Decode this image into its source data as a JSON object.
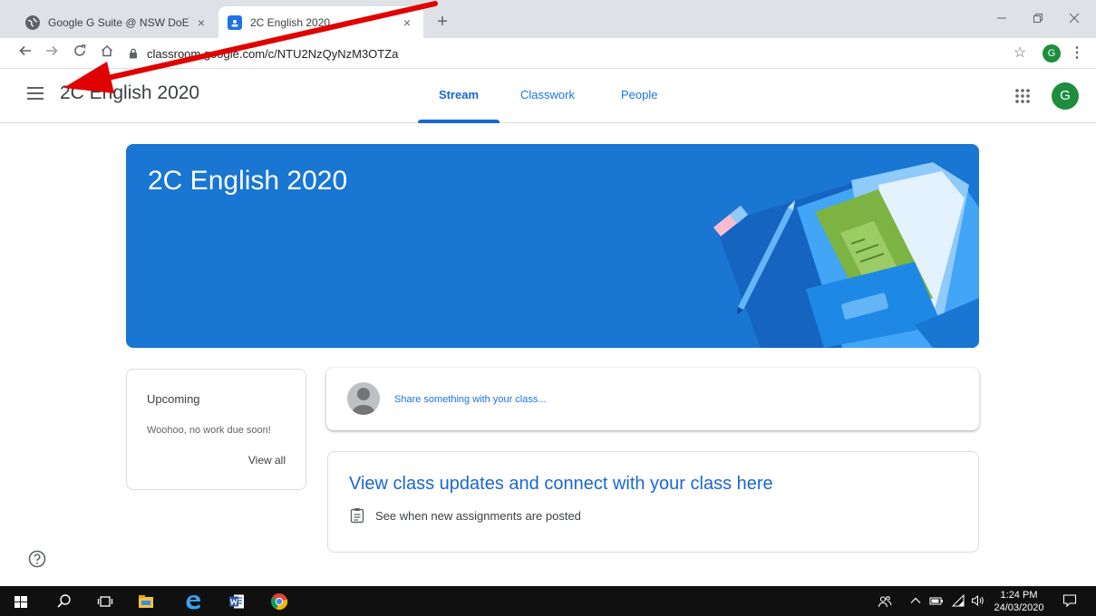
{
  "browser": {
    "tabs": [
      {
        "title": "Google G Suite @ NSW DoE",
        "active": false
      },
      {
        "title": "2C English 2020",
        "active": true
      }
    ],
    "new_tab": "+",
    "close": "×",
    "url": "classroom.google.com/c/NTU2NzQyNzM3OTZa",
    "profile_initial": "G"
  },
  "appbar": {
    "class_name": "2C English 2020",
    "tabs": [
      {
        "label": "Stream",
        "selected": true
      },
      {
        "label": "Classwork",
        "selected": false
      },
      {
        "label": "People",
        "selected": false
      }
    ],
    "avatar_initial": "G"
  },
  "banner": {
    "title": "2C English 2020"
  },
  "upcoming": {
    "heading": "Upcoming",
    "message": "Woohoo, no work due soon!",
    "view_all": "View all"
  },
  "share": {
    "placeholder": "Share something with your class..."
  },
  "updates": {
    "headline": "View class updates and connect with your class here",
    "item": "See when new assignments are posted"
  },
  "taskbar": {
    "time": "1:24 PM",
    "date": "24/03/2020"
  },
  "colors": {
    "accent": "#1967d2",
    "banner": "#1976d2",
    "avatar": "#1e8e3e",
    "annotation": "#e00000"
  }
}
